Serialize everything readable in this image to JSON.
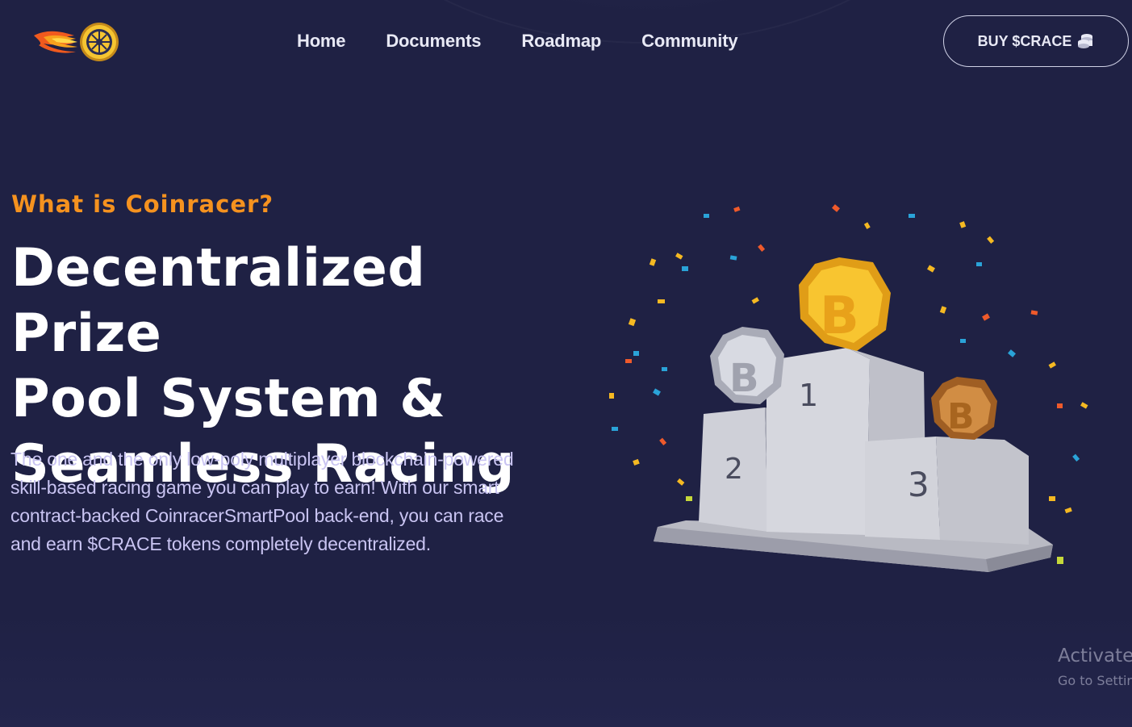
{
  "header": {
    "logo_name": "coinracer-flaming-wheel-logo",
    "nav": [
      {
        "label": "Home"
      },
      {
        "label": "Documents"
      },
      {
        "label": "Roadmap"
      },
      {
        "label": "Community"
      }
    ],
    "buy_button": {
      "label": "BUY $CRACE",
      "icon": "coins-icon"
    }
  },
  "hero": {
    "eyebrow": "What is Coinracer?",
    "headline_lines": [
      "Decentralized Prize",
      "Pool System &",
      "Seamless Racing"
    ],
    "description_lines": [
      "The one and the only low-poly multiplayer blockchain-powered",
      "skill-based racing game you can play to earn! With our smart",
      "contract-backed CoinracerSmartPool back-end, you can race",
      "and earn $CRACE tokens completely decentralized."
    ]
  },
  "illustration": {
    "podium_places": [
      "1",
      "2",
      "3"
    ],
    "coin_icons": [
      "bitcoin-gold-icon",
      "bitcoin-silver-icon",
      "bitcoin-bronze-icon"
    ]
  },
  "os_watermark": {
    "line1": "Activate",
    "line2": "Go to Settir"
  },
  "colors": {
    "background": "#1f2144",
    "accent_orange": "#f5921f",
    "description_text": "#c9c4f2",
    "nav_text": "#e8e9f5",
    "gold": "#f5b922",
    "silver": "#c9cbd3",
    "bronze": "#c7843c"
  }
}
